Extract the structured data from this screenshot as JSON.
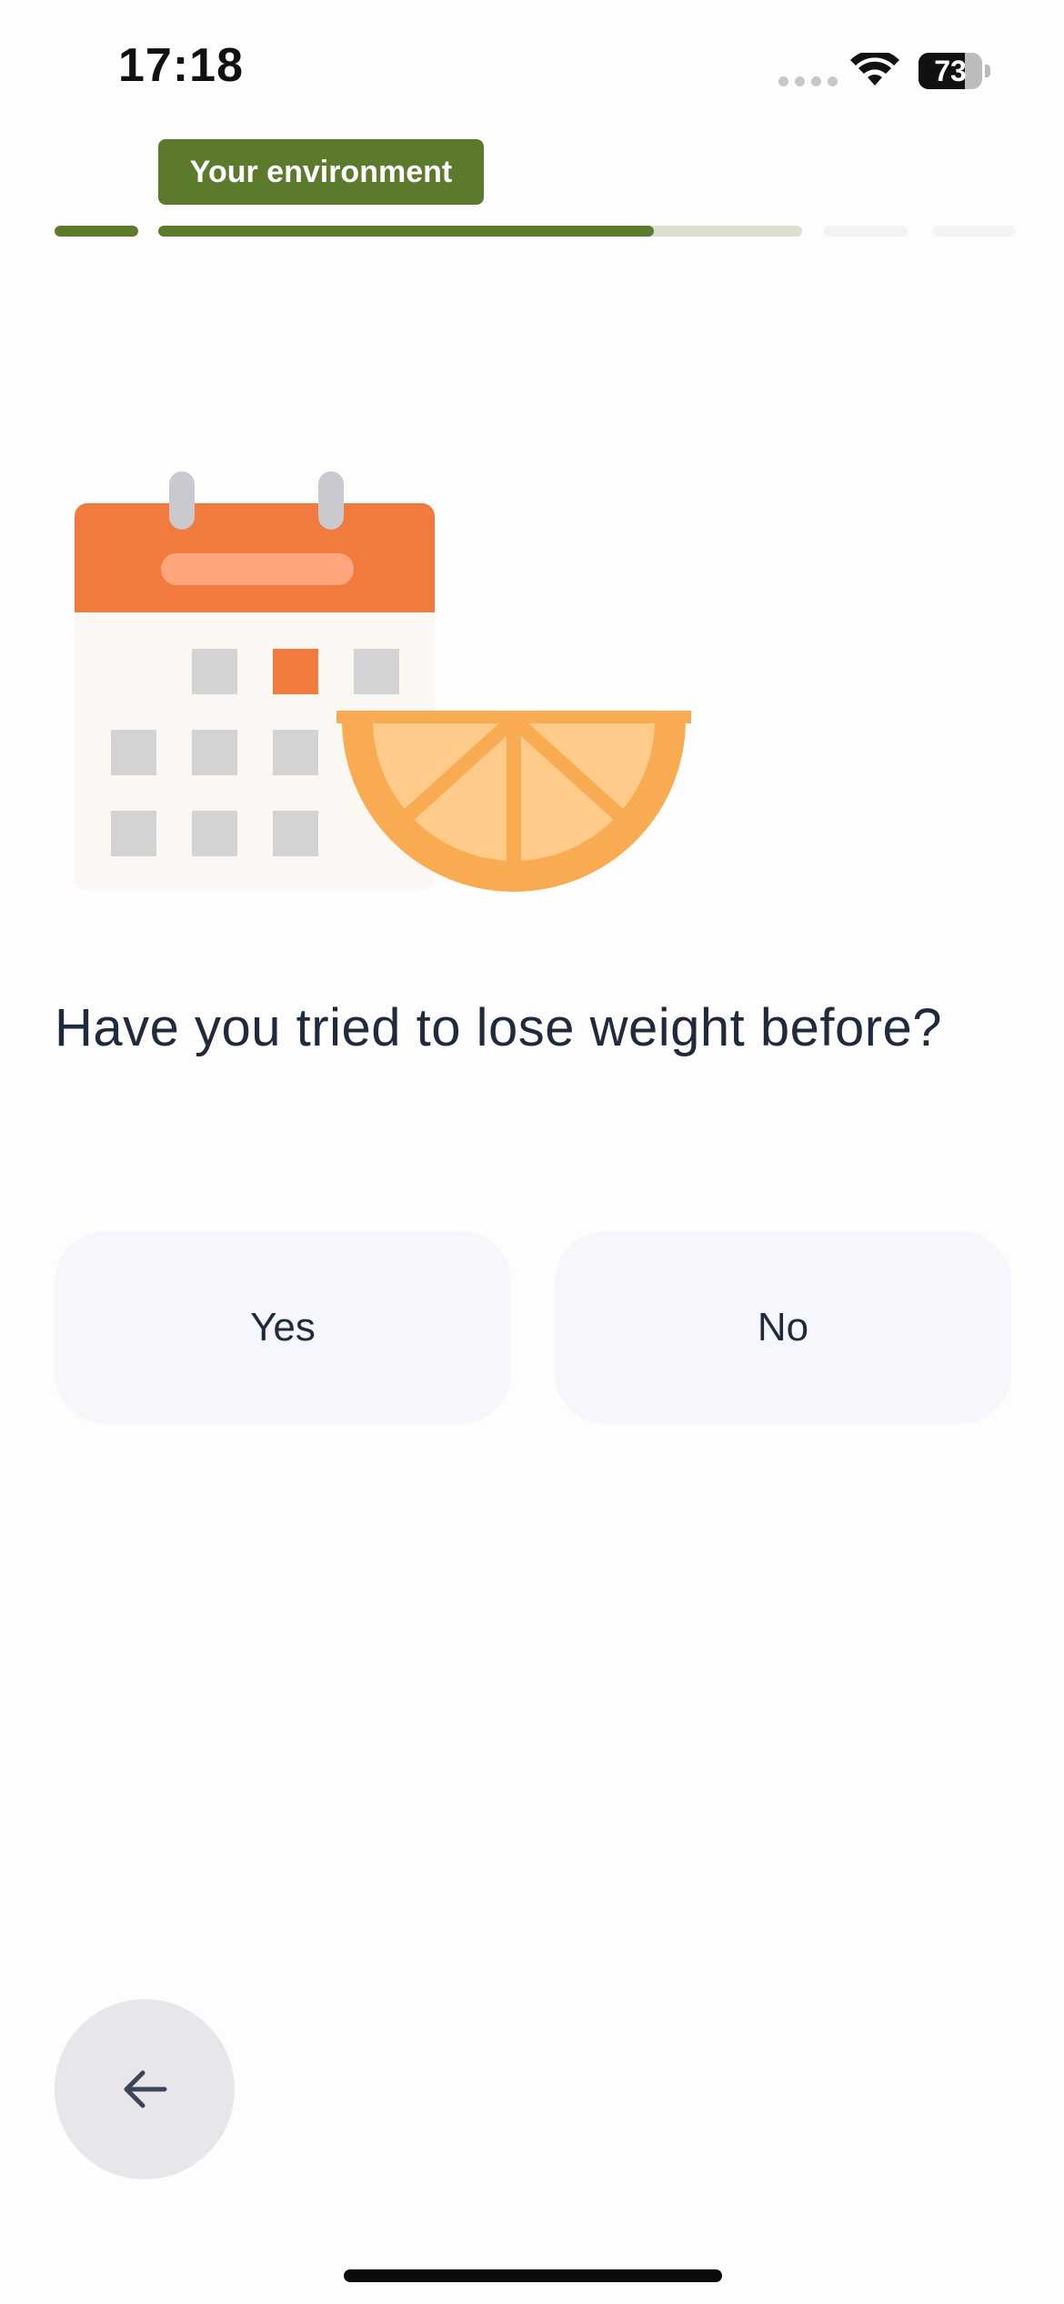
{
  "status_bar": {
    "time": "17:18",
    "battery_percent": "73",
    "battery_level": 0.73
  },
  "header": {
    "section_tag": "Your environment",
    "progress": [
      {
        "state": "complete",
        "fraction": 1.0
      },
      {
        "state": "active",
        "fraction": 0.77
      },
      {
        "state": "upcoming",
        "fraction": 0
      },
      {
        "state": "upcoming",
        "fraction": 0
      }
    ]
  },
  "illustration": {
    "icon": "calendar-with-orange-slice"
  },
  "question": {
    "text": "Have you tried to lose weight before?"
  },
  "answers": {
    "yes_label": "Yes",
    "no_label": "No"
  },
  "navigation": {
    "back_icon": "arrow-left-icon"
  },
  "colors": {
    "accent": "#5b7a2c",
    "calendar_orange": "#f17b3e",
    "orange_fruit": "#f9ab52",
    "button_bg": "#f6f7fc"
  }
}
